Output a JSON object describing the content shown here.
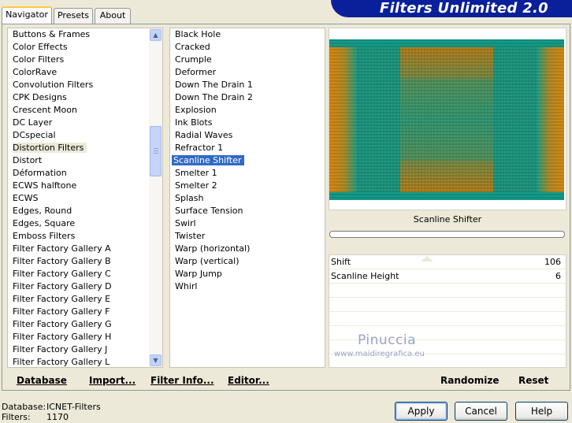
{
  "app": {
    "title": "Filters Unlimited 2.0"
  },
  "tabs": [
    {
      "label": "Navigator",
      "active": true
    },
    {
      "label": "Presets",
      "active": false
    },
    {
      "label": "About",
      "active": false
    }
  ],
  "categories": {
    "items": [
      "Buttons & Frames",
      "Color Effects",
      "Color Filters",
      "ColorRave",
      "Convolution Filters",
      "CPK Designs",
      "Crescent Moon",
      "DC Layer",
      "DCspecial",
      "Distortion Filters",
      "Distort",
      "Déformation",
      "ECWS halftone",
      "ECWS",
      "Edges, Round",
      "Edges, Square",
      "Emboss Filters",
      "Filter Factory Gallery A",
      "Filter Factory Gallery B",
      "Filter Factory Gallery C",
      "Filter Factory Gallery D",
      "Filter Factory Gallery E",
      "Filter Factory Gallery F",
      "Filter Factory Gallery G",
      "Filter Factory Gallery H",
      "Filter Factory Gallery J",
      "Filter Factory Gallery L"
    ],
    "selected": "Distortion Filters",
    "scroll_position": 0.4
  },
  "filters": {
    "items": [
      "Black Hole",
      "Cracked",
      "Crumple",
      "Deformer",
      "Down The Drain 1",
      "Down The Drain 2",
      "Explosion",
      "Ink Blots",
      "Radial Waves",
      "Refractor 1",
      "Scanline Shifter",
      "Smelter 1",
      "Smelter 2",
      "Splash",
      "Surface Tension",
      "Swirl",
      "Twister",
      "Warp (horizontal)",
      "Warp (vertical)",
      "Warp Jump",
      "Whirl"
    ],
    "selected": "Scanline Shifter"
  },
  "preview": {
    "filter_name": "Scanline Shifter"
  },
  "params": [
    {
      "label": "Shift",
      "value": "106"
    },
    {
      "label": "Scanline Height",
      "value": "6"
    }
  ],
  "watermark": {
    "name": "Pinuccia",
    "url": "www.maidiregrafica.eu"
  },
  "panel_buttons": {
    "database": "Database",
    "import": "Import...",
    "filter_info": "Filter Info...",
    "editor": "Editor...",
    "randomize": "Randomize",
    "reset": "Reset"
  },
  "footer": {
    "database_label": "Database:",
    "database_value": "ICNET-Filters",
    "filters_label": "Filters:",
    "filters_value": "1170"
  },
  "dialog_buttons": {
    "apply": "Apply",
    "cancel": "Cancel",
    "help": "Help"
  },
  "colors": {
    "banner": "#0a1f9a",
    "selection": "#316ac5",
    "preview_teal": "#149c8c",
    "preview_orange": "#d9880e"
  }
}
